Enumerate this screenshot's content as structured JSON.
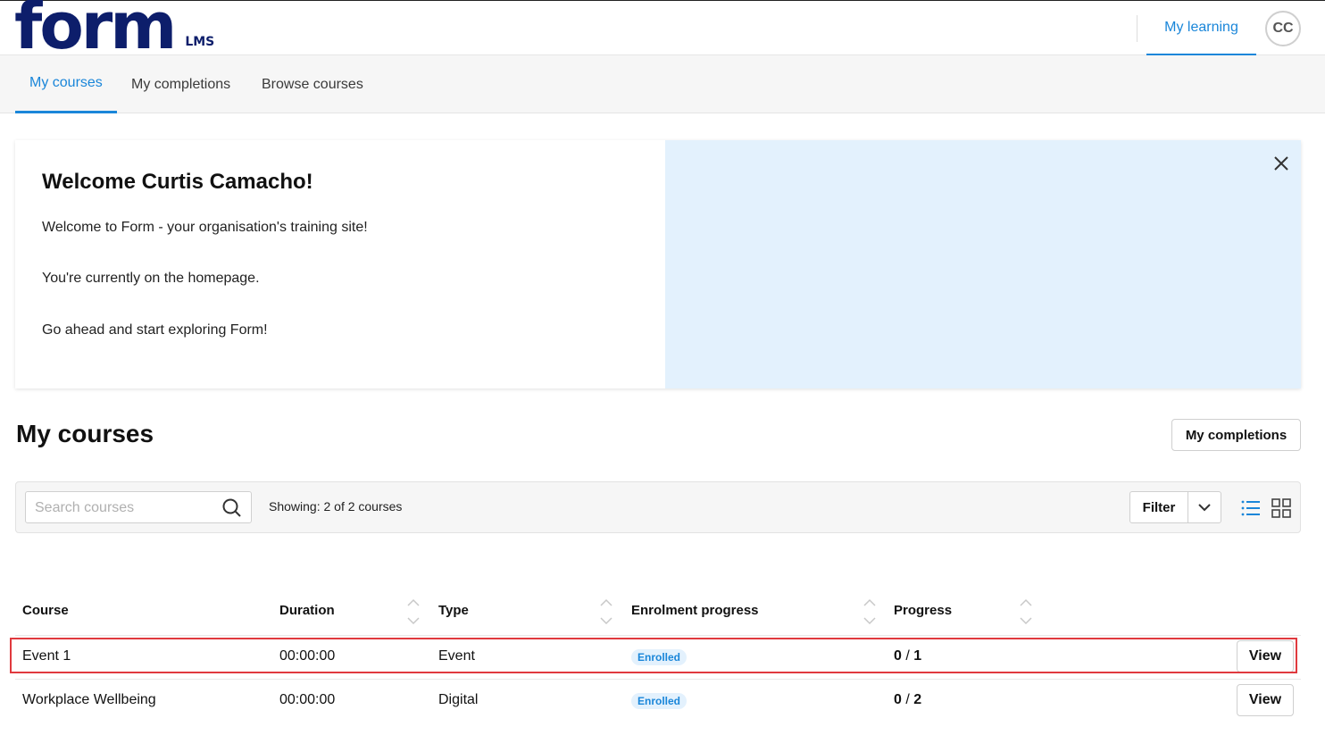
{
  "header": {
    "logo_text": "form",
    "logo_sub": "LMS",
    "my_learning": "My learning",
    "avatar_initials": "CC"
  },
  "subnav": {
    "tabs": [
      {
        "label": "My courses",
        "active": true
      },
      {
        "label": "My completions",
        "active": false
      },
      {
        "label": "Browse courses",
        "active": false
      }
    ]
  },
  "welcome": {
    "title": "Welcome Curtis Camacho!",
    "lines": [
      "Welcome to Form - your organisation's training site!",
      "You're currently on the homepage.",
      "Go ahead and start exploring Form!"
    ],
    "close_icon": "close-icon"
  },
  "courses": {
    "section_title": "My courses",
    "completions_button": "My completions",
    "search_placeholder": "Search courses",
    "showing_text": "Showing: 2 of 2  courses",
    "filter_label": "Filter",
    "columns": [
      "Course",
      "Duration",
      "Type",
      "Enrolment progress",
      "Progress"
    ],
    "rows": [
      {
        "course": "Event 1",
        "duration": "00:00:00",
        "type": "Event",
        "enrolment": "Enrolled",
        "progress_done": "0",
        "progress_total": "1",
        "action": "View"
      },
      {
        "course": "Workplace Wellbeing",
        "duration": "00:00:00",
        "type": "Digital",
        "enrolment": "Enrolled",
        "progress_done": "0",
        "progress_total": "2",
        "action": "View"
      }
    ]
  },
  "colors": {
    "brand": "#0d1e6b",
    "accent": "#1a86d9",
    "highlight": "#e0393e",
    "banner_bg": "#e3f1fd"
  }
}
